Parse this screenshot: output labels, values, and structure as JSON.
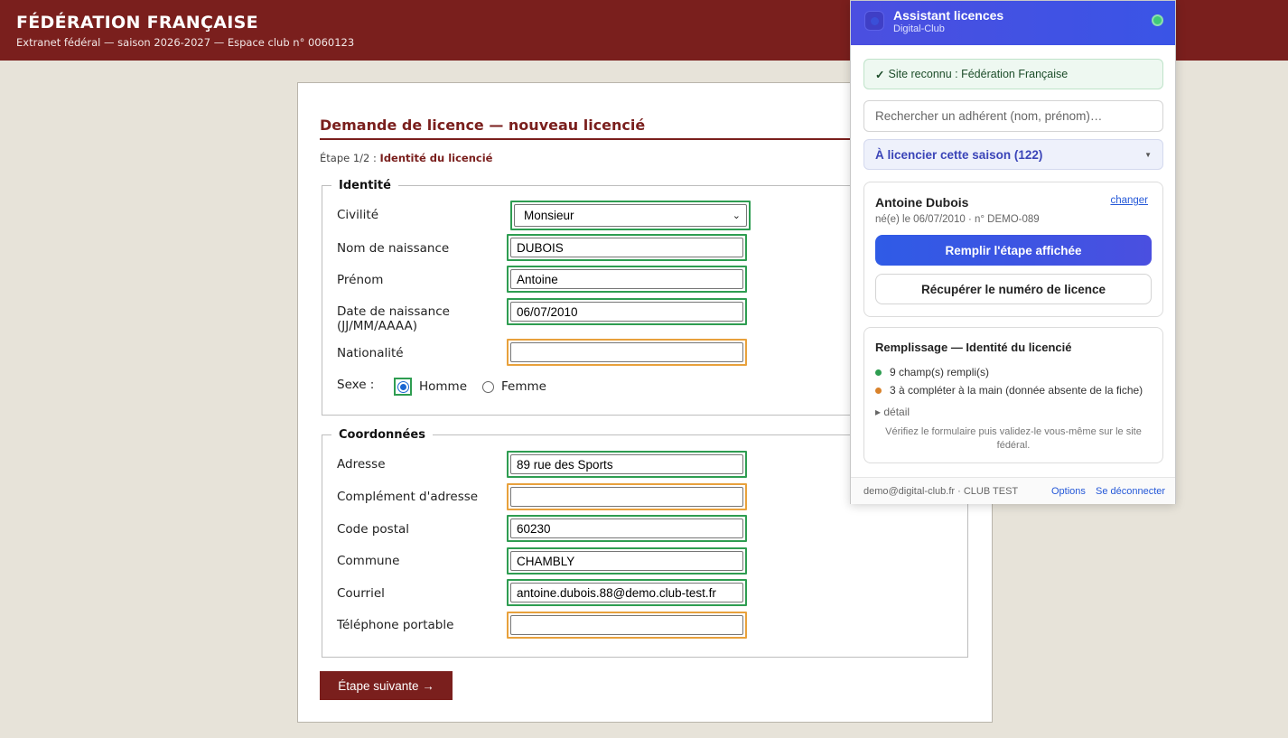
{
  "header": {
    "title": "FÉDÉRATION FRANÇAISE",
    "subtitle": "Extranet fédéral — saison 2026-2027 — Espace club n° 0060123"
  },
  "form": {
    "heading": "Demande de licence — nouveau licencié",
    "step_prefix": "Étape 1/2 :",
    "step_name": "Identité du licencié",
    "identity": {
      "legend": "Identité",
      "civility_label": "Civilité",
      "civility_value": "Monsieur",
      "birth_name_label": "Nom de naissance",
      "birth_name_value": "DUBOIS",
      "first_name_label": "Prénom",
      "first_name_value": "Antoine",
      "birth_date_label_1": "Date de naissance",
      "birth_date_label_2": "(JJ/MM/AAAA)",
      "birth_date_value": "06/07/2010",
      "nationality_label": "Nationalité",
      "nationality_value": "",
      "sex_label": "Sexe :",
      "sex_options": [
        "Homme",
        "Femme"
      ],
      "sex_selected": "Homme"
    },
    "contact": {
      "legend": "Coordonnées",
      "address_label": "Adresse",
      "address_value": "89 rue des Sports",
      "address_extra_label": "Complément d'adresse",
      "address_extra_value": "",
      "postal_code_label": "Code postal",
      "postal_code_value": "60230",
      "city_label": "Commune",
      "city_value": "CHAMBLY",
      "email_label": "Courriel",
      "email_value": "antoine.dubois.88@demo.club-test.fr",
      "mobile_label": "Téléphone portable",
      "mobile_value": ""
    },
    "next_button": "Étape suivante →"
  },
  "extension": {
    "title": "Assistant licences",
    "subtitle": "Digital-Club",
    "site_recognized": "Site reconnu : Fédération Française",
    "search_placeholder": "Rechercher un adhérent (nom, prénom)…",
    "season_select": "À licencier cette saison (122)",
    "member": {
      "name": "Antoine Dubois",
      "change_link": "changer",
      "meta": "né(e) le 06/07/2010 · n° DEMO-089"
    },
    "fill_button": "Remplir l'étape affichée",
    "licence_button": "Récupérer le numéro de licence",
    "summary": {
      "title": "Remplissage — Identité du licencié",
      "filled": "9 champ(s) rempli(s)",
      "to_complete": "3 à compléter à la main (donnée absente de la fiche)",
      "detail": "▸ détail",
      "note": "Vérifiez le formulaire puis validez-le vous-même sur le site fédéral."
    },
    "footer": {
      "account": "demo@digital-club.fr · CLUB TEST",
      "options": "Options",
      "logout": "Se déconnecter"
    },
    "colors": {
      "filled_outline": "#2e9d51",
      "missing_outline": "#e8a13c",
      "brand": "#4b4fe0"
    }
  }
}
